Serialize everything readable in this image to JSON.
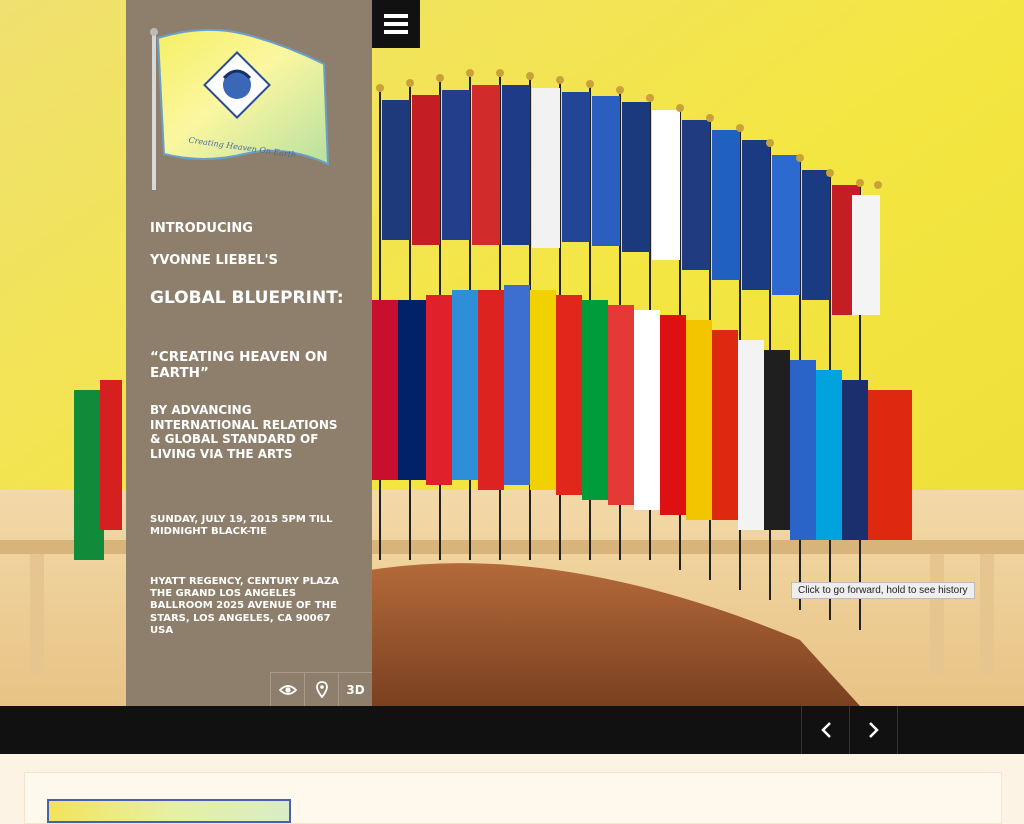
{
  "panel": {
    "intro": "INTRODUCING",
    "name": "YVONNE LIEBEL'S",
    "title": "GLOBAL BLUEPRINT:",
    "subtitle": "“CREATING HEAVEN ON EARTH”",
    "description": "BY ADVANCING INTERNATIONAL RELATIONS & GLOBAL STANDARD OF LIVING VIA THE ARTS",
    "date": "SUNDAY, JULY 19, 2015 5PM TILL MIDNIGHT BLACK-TIE",
    "venue": "HYATT REGENCY, CENTURY PLAZA THE GRAND LOS ANGELES BALLROOM 2025 AVENUE OF THE STARS, LOS ANGELES, CA 90067 USA",
    "logo_motto": "Creating Heaven On Earth",
    "icons": [
      {
        "name": "eye-icon"
      },
      {
        "name": "map-pin-icon"
      },
      {
        "label": "3D"
      }
    ]
  },
  "tooltip": "Click to go forward, hold to see history",
  "colors": {
    "panel_bg": "#8e7f6d",
    "hero_bg": "#f0de4a",
    "nav_bg": "#111111",
    "page_bg": "#fdf3e4"
  }
}
